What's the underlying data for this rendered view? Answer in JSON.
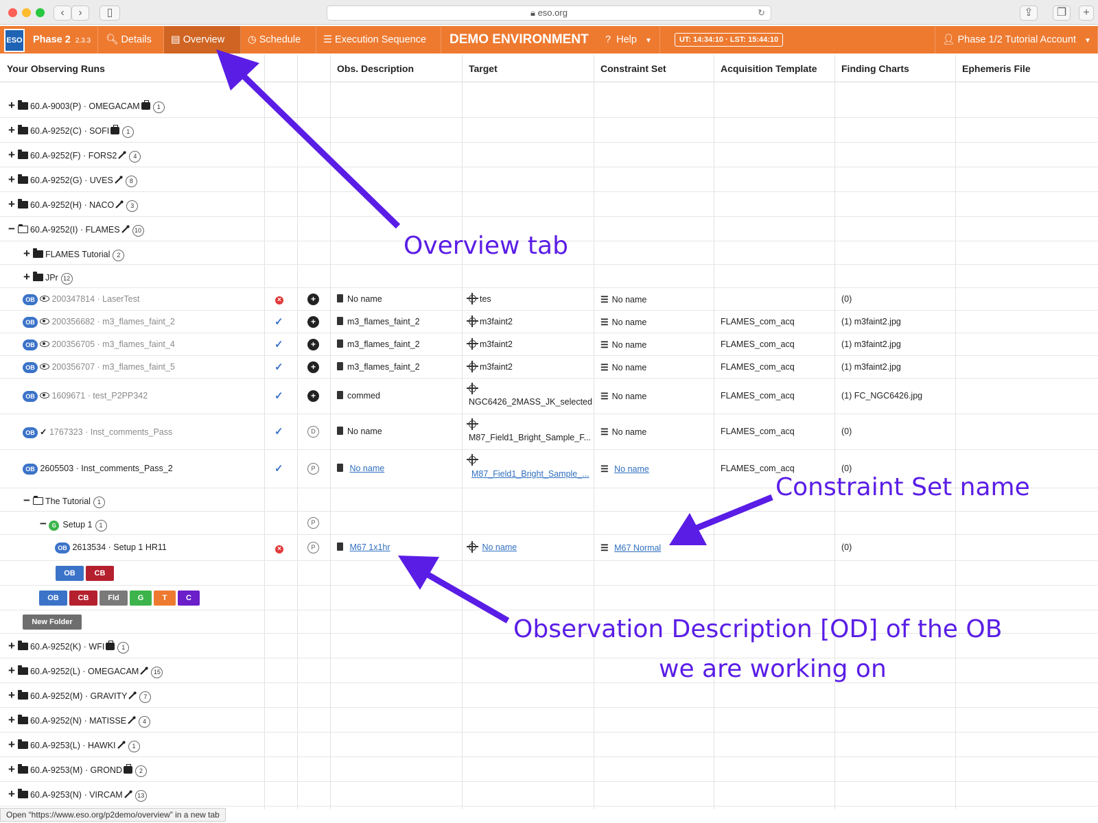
{
  "browser": {
    "url": "eso.org"
  },
  "appbar": {
    "logo": "ESO",
    "app_name": "Phase 2",
    "version": "2.3.3",
    "tabs": [
      {
        "label": "Details"
      },
      {
        "label": "Overview"
      },
      {
        "label": "Schedule"
      },
      {
        "label": "Execution Sequence"
      }
    ],
    "demo": "DEMO ENVIRONMENT",
    "help": "Help",
    "clock": "UT: 14:34:10 · LST: 15:44:10",
    "account": "Phase 1/2 Tutorial Account"
  },
  "columns": [
    "Your Observing Runs",
    "Obs. Description",
    "Target",
    "Constraint Set",
    "Acquisition Template",
    "Finding Charts",
    "Ephemeris File"
  ],
  "runs_top": [
    {
      "label": "60.A-9003(P) · OMEGACAM",
      "count": "1",
      "icon": "suitcase-icon"
    },
    {
      "label": "60.A-9252(C) · SOFI",
      "count": "1",
      "icon": "suitcase-icon"
    },
    {
      "label": "60.A-9252(F) · FORS2",
      "count": "4",
      "icon": "wrench-icon"
    },
    {
      "label": "60.A-9252(G) · UVES",
      "count": "8",
      "icon": "wrench-icon"
    },
    {
      "label": "60.A-9252(H) · NACO",
      "count": "3",
      "icon": "wrench-icon"
    },
    {
      "label": "60.A-9252(I) · FLAMES",
      "count": "10",
      "icon": "wrench-icon"
    }
  ],
  "subfolders": [
    {
      "label": "FLAMES Tutorial",
      "count": "2"
    },
    {
      "label": "JPr",
      "count": "12"
    }
  ],
  "obs": [
    {
      "id": "200347814 · LaserTest",
      "od": "No name",
      "target": "tes",
      "cs": "No name",
      "acq": "",
      "fc": "(0)"
    },
    {
      "id": "200356682 · m3_flames_faint_2",
      "od": "m3_flames_faint_2",
      "target": "m3faint2",
      "cs": "No name",
      "acq": "FLAMES_com_acq",
      "fc": "(1) m3faint2.jpg"
    },
    {
      "id": "200356705 · m3_flames_faint_4",
      "od": "m3_flames_faint_2",
      "target": "m3faint2",
      "cs": "No name",
      "acq": "FLAMES_com_acq",
      "fc": "(1) m3faint2.jpg"
    },
    {
      "id": "200356707 · m3_flames_faint_5",
      "od": "m3_flames_faint_2",
      "target": "m3faint2",
      "cs": "No name",
      "acq": "FLAMES_com_acq",
      "fc": "(1) m3faint2.jpg"
    },
    {
      "id": "1609671 · test_P2PP342",
      "od": "commed",
      "target": "NGC6426_2MASS_JK_selected",
      "cs": "No name",
      "acq": "FLAMES_com_acq",
      "fc": "(1) FC_NGC6426.jpg"
    },
    {
      "id": "1767323 · Inst_comments_Pass",
      "od": "No name",
      "target": "M87_Field1_Bright_Sample_F...",
      "cs": "No name",
      "acq": "FLAMES_com_acq",
      "fc": "(0)",
      "status_letter": "D"
    },
    {
      "id": "2605503 · Inst_comments_Pass_2",
      "od": "No name",
      "target": "M87_Field1_Bright_Sample_...",
      "cs": "No name",
      "acq": "FLAMES_com_acq",
      "fc": "(0)",
      "status_letter": "P"
    }
  ],
  "tutorial": {
    "folder": "The Tutorial",
    "folder_count": "1",
    "group_badge": "G",
    "group": "Setup 1",
    "group_count": "1",
    "group_status": "P",
    "ob_id": "2613534 · Setup 1 HR11",
    "ob_status": "P",
    "od": "M67 1x1hr",
    "target": "No name",
    "cs": "M67 Normal",
    "fc": "(0)"
  },
  "buttons": {
    "ob": "OB",
    "cb": "CB",
    "fld": "Fld",
    "g": "G",
    "t": "T",
    "c": "C",
    "new_folder": "New Folder"
  },
  "runs_bottom": [
    {
      "label": "60.A-9252(K) · WFI",
      "count": "1",
      "icon": "suitcase-icon"
    },
    {
      "label": "60.A-9252(L) · OMEGACAM",
      "count": "15",
      "icon": "wrench-icon"
    },
    {
      "label": "60.A-9252(M) · GRAVITY",
      "count": "7",
      "icon": "wrench-icon"
    },
    {
      "label": "60.A-9252(N) · MATISSE",
      "count": "4",
      "icon": "wrench-icon"
    },
    {
      "label": "60.A-9253(L) · HAWKI",
      "count": "1",
      "icon": "wrench-icon"
    },
    {
      "label": "60.A-9253(M) · GROND",
      "count": "2",
      "icon": "suitcase-icon"
    },
    {
      "label": "60.A-9253(N) · VIRCAM",
      "count": "13",
      "icon": "wrench-icon"
    }
  ],
  "annotations": {
    "overview": "Overview tab",
    "constraint": "Constraint Set name",
    "od_line1": "Observation Description [OD] of the OB",
    "od_line2": "we are working on"
  },
  "statusbar": "Open “https://www.eso.org/p2demo/overview” in a new tab",
  "colors": {
    "appbar": "#ee7a30",
    "active_tab": "#cf6423",
    "annotation": "#5a1de6",
    "ob_badge": "#3b73c8",
    "cb_button": "#b5202e"
  }
}
